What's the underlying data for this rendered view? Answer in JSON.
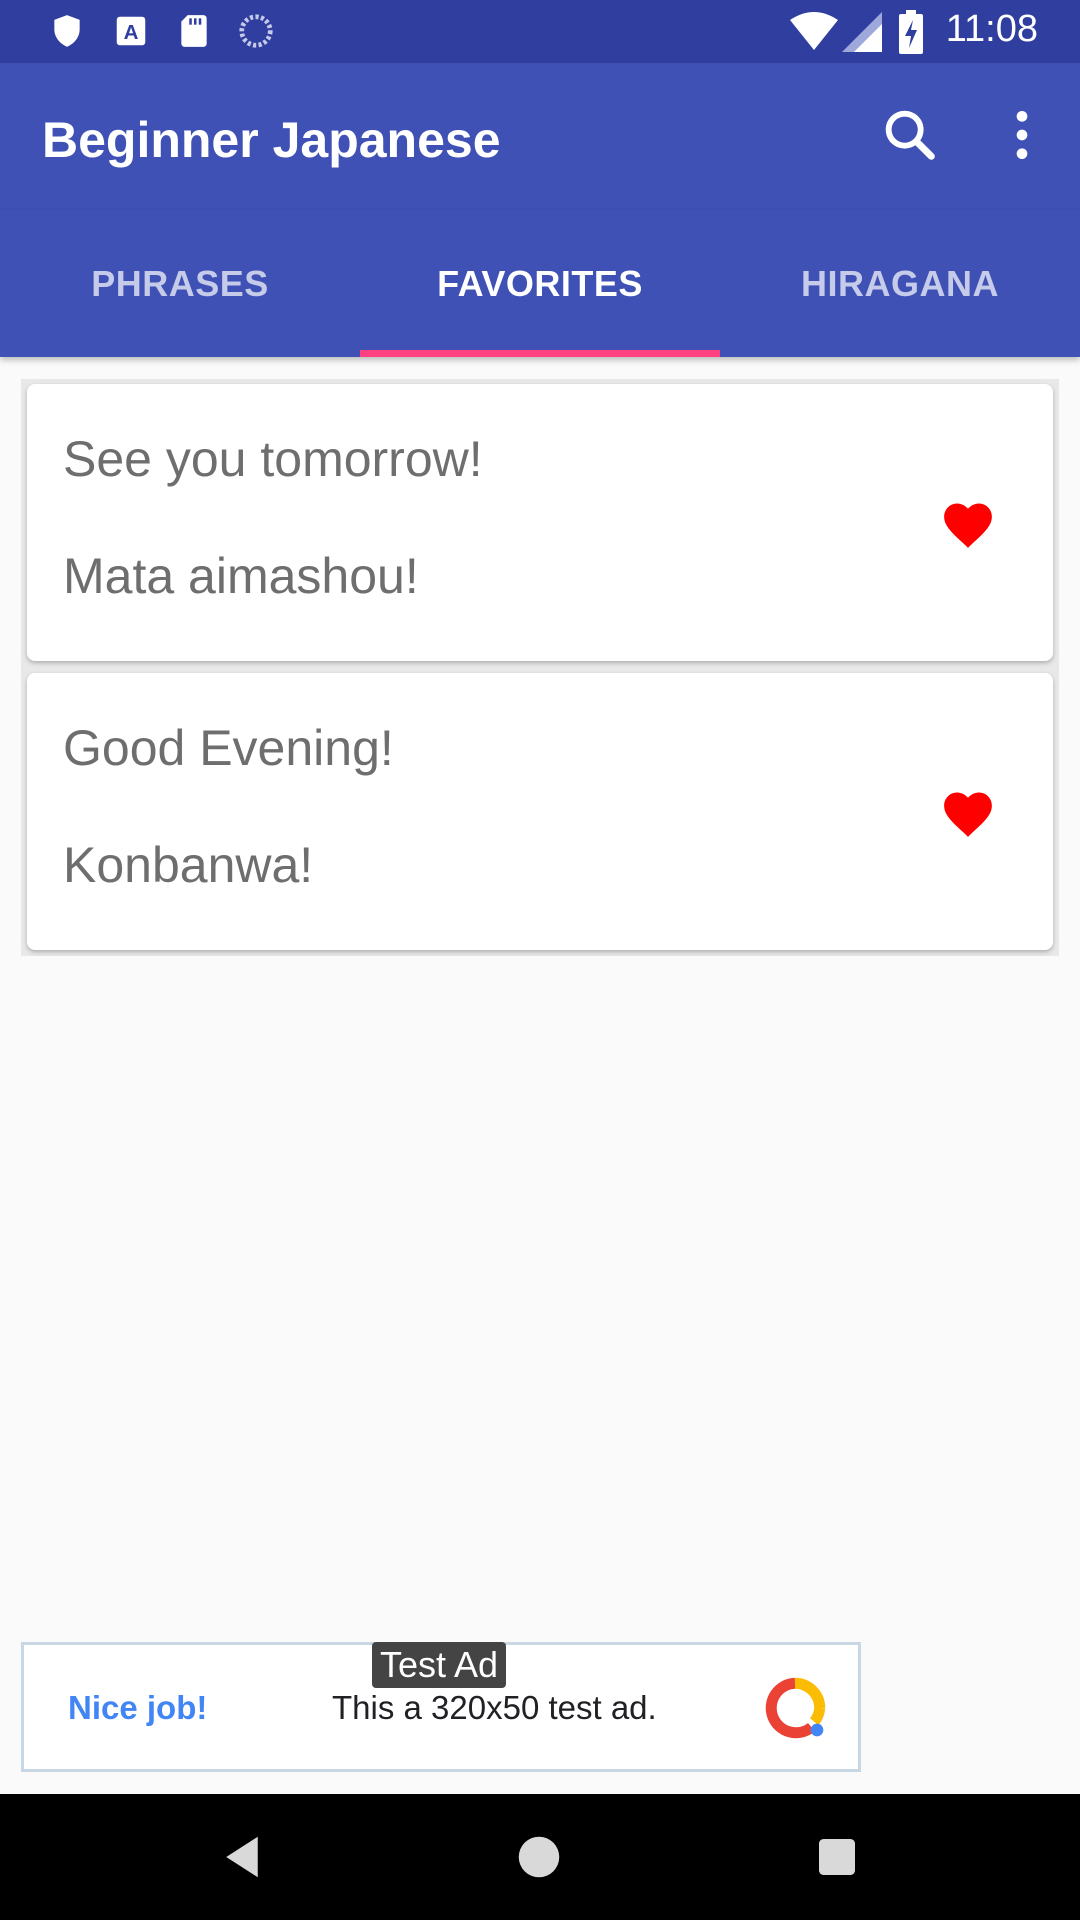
{
  "status_bar": {
    "time": "11:08",
    "left_icons": [
      "shield-icon",
      "accessibility-a-icon",
      "sd-card-icon",
      "sync-icon"
    ],
    "right_icons": [
      "wifi-icon",
      "signal-icon",
      "battery-charging-icon"
    ]
  },
  "app_bar": {
    "title": "Beginner Japanese",
    "actions": [
      "search-icon",
      "more-vert-icon"
    ]
  },
  "tabs": [
    {
      "label": "PHRASES",
      "active": false
    },
    {
      "label": "FAVORITES",
      "active": true
    },
    {
      "label": "HIRAGANA",
      "active": false
    }
  ],
  "favorites": [
    {
      "english": "See you tomorrow!",
      "japanese": "Mata aimashou!",
      "favorited": true
    },
    {
      "english": "Good Evening!",
      "japanese": "Konbanwa!",
      "favorited": true
    }
  ],
  "ad": {
    "label": "Test Ad",
    "headline": "Nice job!",
    "body": "This a 320x50 test ad."
  },
  "colors": {
    "primary": "#3f51b5",
    "primary_dark": "#303f9f",
    "accent": "#ff4081",
    "heart": "#ff0000"
  }
}
